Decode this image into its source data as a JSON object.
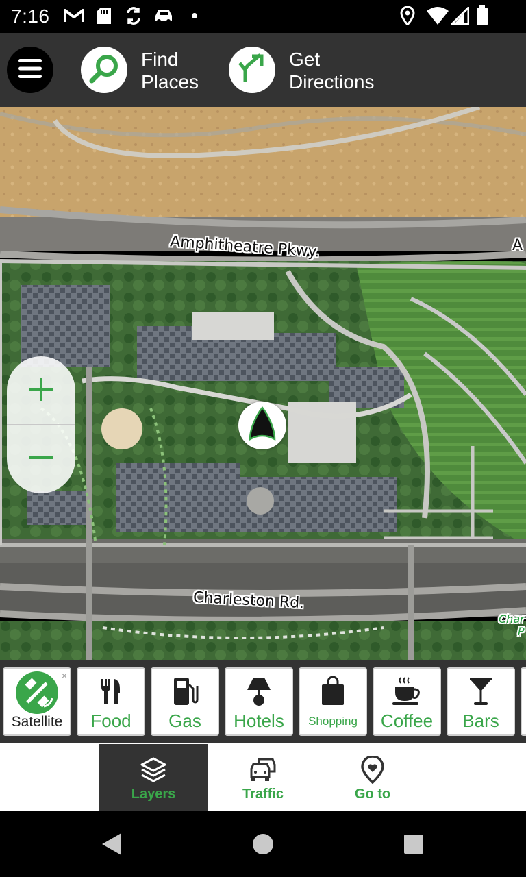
{
  "status_bar": {
    "time": "7:16",
    "left_icons": [
      "gmail-icon",
      "sd-card-icon",
      "sync-icon",
      "car-icon",
      "dot-icon"
    ],
    "right_icons": [
      "location-icon",
      "wifi-icon",
      "signal-icon",
      "battery-icon"
    ]
  },
  "top_bar": {
    "menu_icon": "hamburger-menu-icon",
    "find_places": {
      "line1": "Find",
      "line2": "Places",
      "icon": "search-icon"
    },
    "get_directions": {
      "line1": "Get",
      "line2": "Directions",
      "icon": "directions-arrow-icon"
    }
  },
  "map": {
    "street_labels": [
      "Amphitheatre Pkwy.",
      "Charleston Rd.",
      "A",
      "Char",
      "P"
    ],
    "zoom_in_icon": "plus-icon",
    "zoom_out_icon": "minus-icon",
    "current_location_icon": "navigation-arrow-icon"
  },
  "categories": [
    {
      "label": "Satellite",
      "icon": "satellite-icon",
      "active": true,
      "close": "×"
    },
    {
      "label": "Food",
      "icon": "fork-knife-icon"
    },
    {
      "label": "Gas",
      "icon": "gas-pump-icon"
    },
    {
      "label": "Hotels",
      "icon": "lamp-icon"
    },
    {
      "label": "Shopping",
      "icon": "shopping-bag-icon"
    },
    {
      "label": "Coffee",
      "icon": "coffee-cup-icon"
    },
    {
      "label": "Bars",
      "icon": "cocktail-icon"
    }
  ],
  "bottom_tabs": [
    {
      "label": "Layers",
      "icon": "layers-icon",
      "active": true
    },
    {
      "label": "Traffic",
      "icon": "traffic-cars-icon",
      "active": false
    },
    {
      "label": "Go to",
      "icon": "heart-pin-icon",
      "active": false
    }
  ],
  "nav_bar": {
    "back": "back-triangle-icon",
    "home": "home-circle-icon",
    "recents": "recents-square-icon"
  },
  "colors": {
    "accent": "#3aa64a",
    "bar": "#333333",
    "status": "#000000"
  }
}
